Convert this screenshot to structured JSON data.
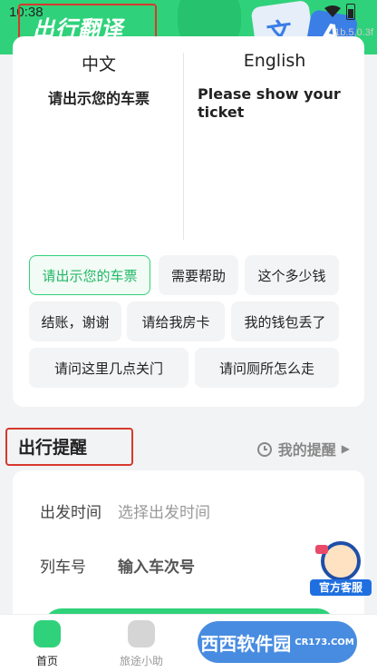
{
  "status_bar": {
    "time": "10:38"
  },
  "header": {
    "title": "出行翻译",
    "badge_left": "文",
    "badge_right": "A",
    "version": "1b.5.0.3f"
  },
  "translation": {
    "source_lang": "中文",
    "target_lang": "English",
    "source_text": "请出示您的车票",
    "target_text": "Please show your ticket"
  },
  "phrases": [
    {
      "label": "请出示您的车票",
      "active": true
    },
    {
      "label": "需要帮助"
    },
    {
      "label": "这个多少钱"
    },
    {
      "label": "结账，谢谢"
    },
    {
      "label": "请给我房卡"
    },
    {
      "label": "我的钱包丢了"
    },
    {
      "label": "请问这里几点关门"
    },
    {
      "label": "请问厕所怎么走"
    }
  ],
  "reminder": {
    "title": "出行提醒",
    "my_reminders": "我的提醒",
    "depart_label": "出发时间",
    "depart_placeholder": "选择出发时间",
    "train_label": "列车号",
    "train_placeholder": "输入车次号"
  },
  "service": {
    "label": "官方客服"
  },
  "tabs": [
    {
      "label": "首页",
      "active": true
    },
    {
      "label": "旅途小助"
    }
  ],
  "watermark": {
    "text": "西西软件园",
    "sub": "CR173.COM"
  },
  "colors": {
    "brand": "#2fd27a",
    "highlight_frame": "#d7382e"
  }
}
